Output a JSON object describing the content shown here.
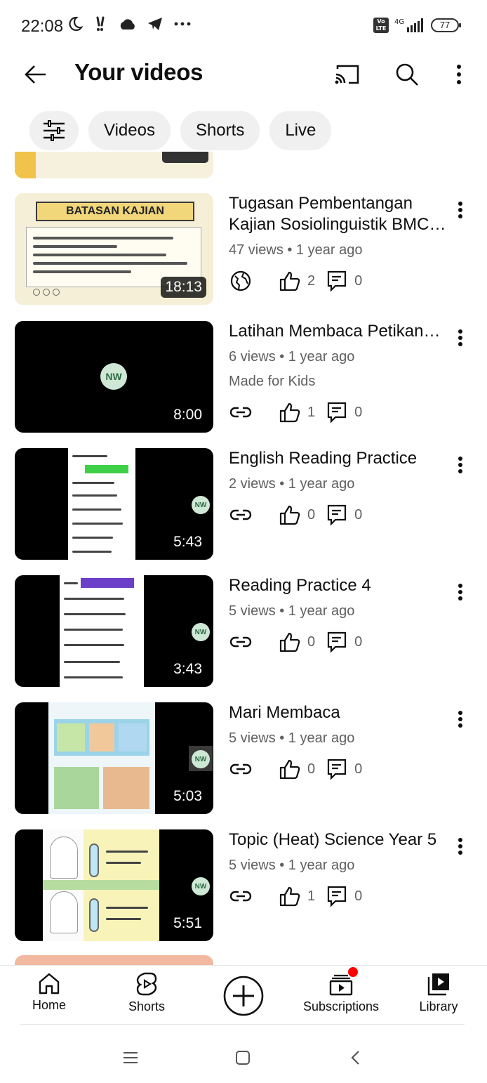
{
  "status_bar": {
    "time": "22:08",
    "network": "4G",
    "lte": "Vo LTE",
    "battery": "77"
  },
  "header": {
    "title": "Your videos",
    "icons": [
      "back-arrow-icon",
      "cast-icon",
      "search-icon",
      "more-vert-icon"
    ]
  },
  "chips": [
    {
      "label": "",
      "icon": "filter-sliders-icon"
    },
    {
      "label": "Videos"
    },
    {
      "label": "Shorts"
    },
    {
      "label": "Live"
    }
  ],
  "videos": [
    {
      "title": "Tugasan Pembentangan Kajian Sosiolinguistik BMC…",
      "meta": "47 views • 1 year ago",
      "duration": "18:13",
      "visibility_icon": "public-globe-icon",
      "likes": "2",
      "comments": "0",
      "thumb_text": "BATASAN KAJIAN"
    },
    {
      "title": "Latihan Membaca Petikan…",
      "meta": "6 views • 1 year ago",
      "label": "Made for Kids",
      "duration": "8:00",
      "visibility_icon": "unlisted-link-icon",
      "likes": "1",
      "comments": "0",
      "thumb_text": "NW"
    },
    {
      "title": "English Reading Practice",
      "meta": "2 views • 1 year ago",
      "duration": "5:43",
      "visibility_icon": "unlisted-link-icon",
      "likes": "0",
      "comments": "0",
      "thumb_text": "NW"
    },
    {
      "title": "Reading Practice 4",
      "meta": "5 views • 1 year ago",
      "duration": "3:43",
      "visibility_icon": "unlisted-link-icon",
      "likes": "0",
      "comments": "0",
      "thumb_text": "NW"
    },
    {
      "title": "Mari Membaca",
      "meta": "5 views • 1 year ago",
      "duration": "5:03",
      "visibility_icon": "unlisted-link-icon",
      "likes": "0",
      "comments": "0",
      "thumb_text": "NW"
    },
    {
      "title": "Topic (Heat) Science Year 5",
      "meta": "5 views • 1 year ago",
      "duration": "5:51",
      "visibility_icon": "unlisted-link-icon",
      "likes": "1",
      "comments": "0",
      "thumb_text": "NW"
    }
  ],
  "bottom_nav": {
    "home": "Home",
    "shorts": "Shorts",
    "subscriptions": "Subscriptions",
    "library": "Library"
  },
  "colors": {
    "chip_bg": "#f0f0f0",
    "text_primary": "#0f0f0f",
    "text_secondary": "#606060",
    "notification_dot": "#ff0000"
  }
}
